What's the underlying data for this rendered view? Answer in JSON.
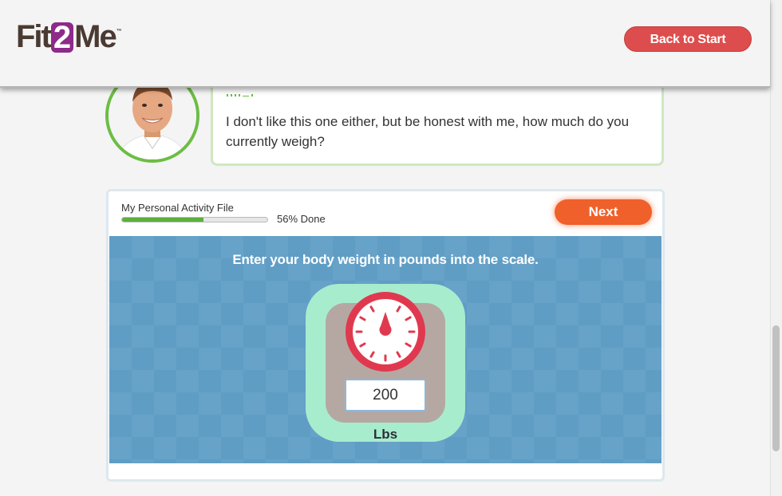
{
  "header": {
    "logo": {
      "part1": "Fit",
      "part2": "2",
      "part3": "Me",
      "trademark": "™"
    },
    "back_button_label": "Back to Start"
  },
  "chat": {
    "message": "I don't like this one either, but be honest with me, how much do you currently weigh?"
  },
  "activity": {
    "file_label": "My Personal Activity File",
    "progress_percent": 56,
    "progress_text": "56% Done",
    "next_button_label": "Next",
    "instruction": "Enter your body weight in pounds into the scale.",
    "weight_value": "200",
    "unit_label": "Lbs"
  },
  "colors": {
    "brand_purple": "#8e2a8a",
    "back_button": "#de4d4d",
    "next_button": "#f0602a",
    "progress_green": "#5bb13b",
    "panel_blue": "#5f9dc5",
    "scale_mint": "#a8ecce",
    "dial_red": "#e0394f"
  },
  "icons": {
    "avatar": "coach-avatar",
    "dial": "scale-dial-icon"
  }
}
